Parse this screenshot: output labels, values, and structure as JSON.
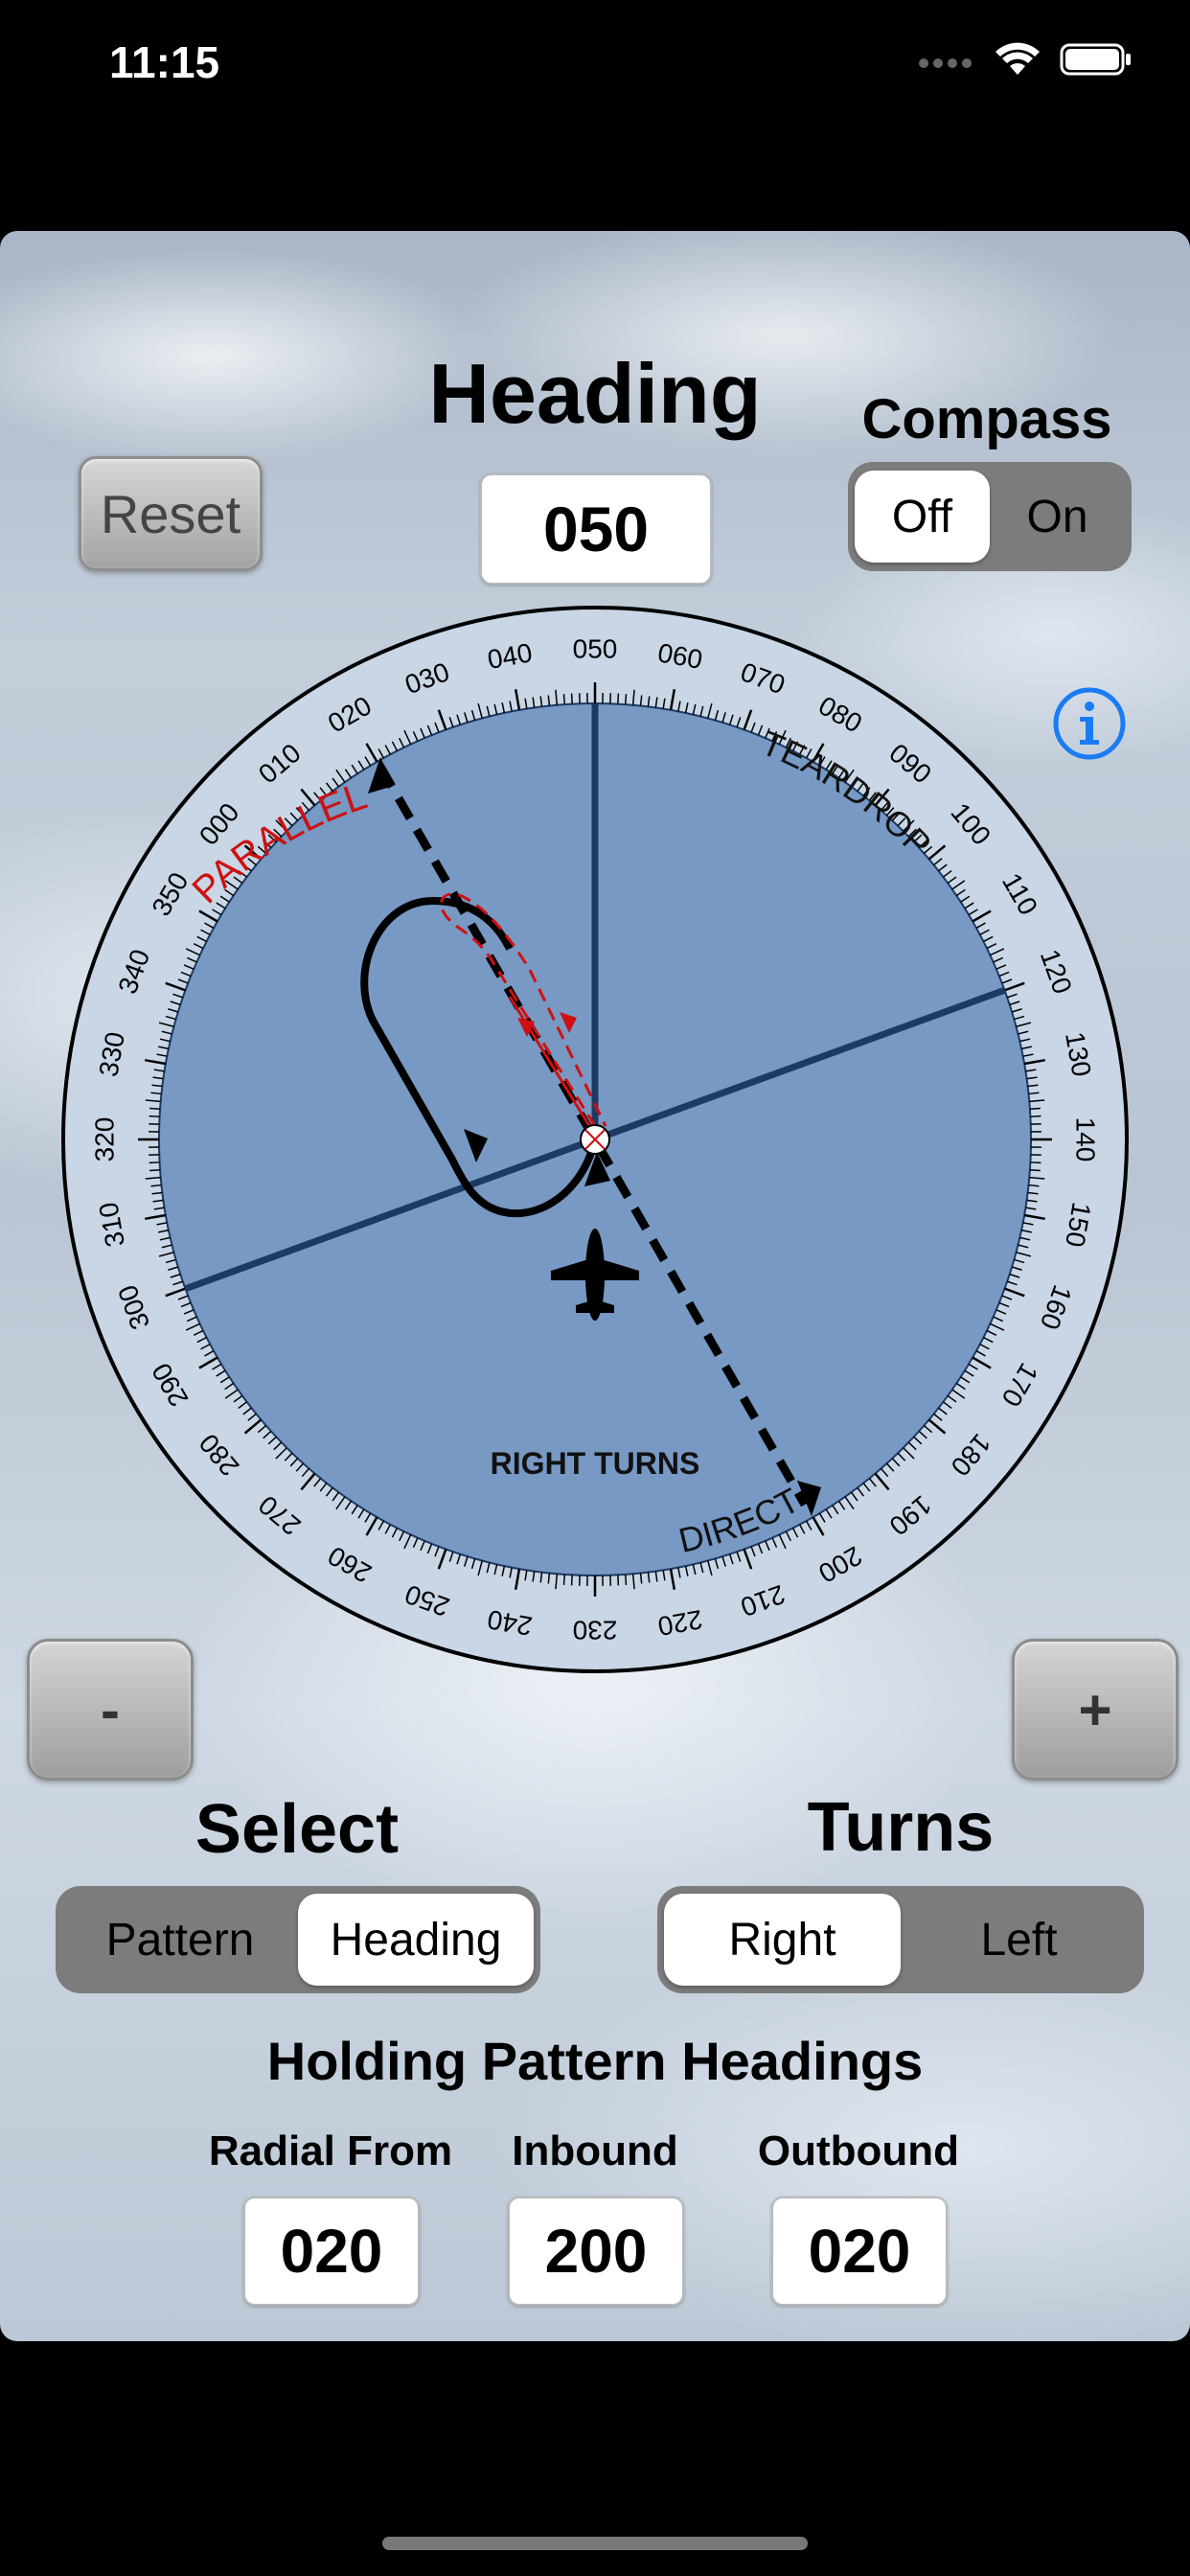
{
  "status": {
    "time": "11:15"
  },
  "header": {
    "title": "Heading",
    "value": "050",
    "reset_label": "Reset",
    "compass_title": "Compass",
    "compass_options": [
      "Off",
      "On"
    ],
    "compass_selected": "Off"
  },
  "dial": {
    "heading": 50,
    "labels": {
      "parallel": "PARALLEL",
      "teardrop": "TEARDROP",
      "direct": "DIRECT",
      "turn_direction": "RIGHT TURNS"
    },
    "colors": {
      "face": "#7799c4",
      "ring": "#c9d6e6",
      "axis": "#1d3a63",
      "parallel_label": "#cc1111",
      "entry_path": "#d01010"
    },
    "icons": {
      "info": "info-icon",
      "aircraft": "airplane-icon"
    }
  },
  "controls": {
    "minus_label": "-",
    "plus_label": "+",
    "select_title": "Select",
    "select_options": [
      "Pattern",
      "Heading"
    ],
    "select_selected": "Heading",
    "turns_title": "Turns",
    "turns_options": [
      "Right",
      "Left"
    ],
    "turns_selected": "Right"
  },
  "holding": {
    "title": "Holding Pattern Headings",
    "radial_label": "Radial From",
    "radial_value": "020",
    "inbound_label": "Inbound",
    "inbound_value": "200",
    "outbound_label": "Outbound",
    "outbound_value": "020"
  }
}
